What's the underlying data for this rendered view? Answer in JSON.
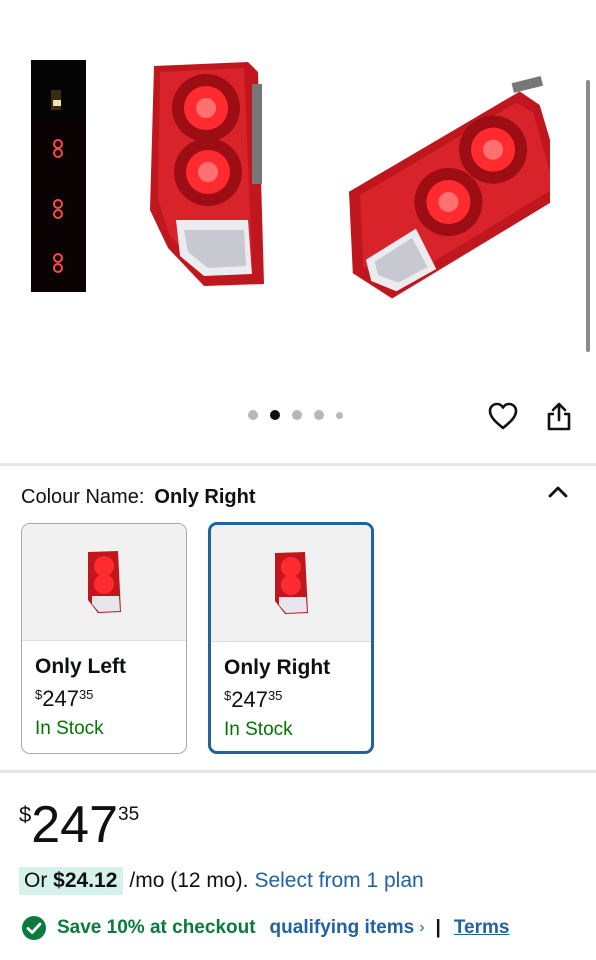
{
  "gallery": {
    "thumbnails": [
      "tail-light-thumb-1",
      "tail-light-thumb-2",
      "tail-light-thumb-3",
      "tail-light-thumb-4"
    ],
    "dot_count": 5,
    "active_dot": 2
  },
  "colour": {
    "label": "Colour Name:",
    "selected": "Only Right"
  },
  "options": [
    {
      "name": "Only Left",
      "currency": "$",
      "whole": "247",
      "fraction": "35",
      "stock": "In Stock"
    },
    {
      "name": "Only Right",
      "currency": "$",
      "whole": "247",
      "fraction": "35",
      "stock": "In Stock"
    }
  ],
  "price": {
    "currency": "$",
    "whole": "247",
    "fraction": "35"
  },
  "monthly": {
    "prefix": "Or",
    "amount": "$24.12",
    "suffix": "/mo (12 mo).",
    "link": "Select from 1 plan"
  },
  "promo": {
    "save_text": "Save 10% at checkout",
    "qualifying": "qualifying items",
    "chevron": "›",
    "separator": "|",
    "terms": "Terms"
  },
  "colors": {
    "accent_blue": "#2162a1",
    "stock_green": "#007600",
    "save_green": "#0a7a3e",
    "highlight": "#d5f2eb"
  }
}
